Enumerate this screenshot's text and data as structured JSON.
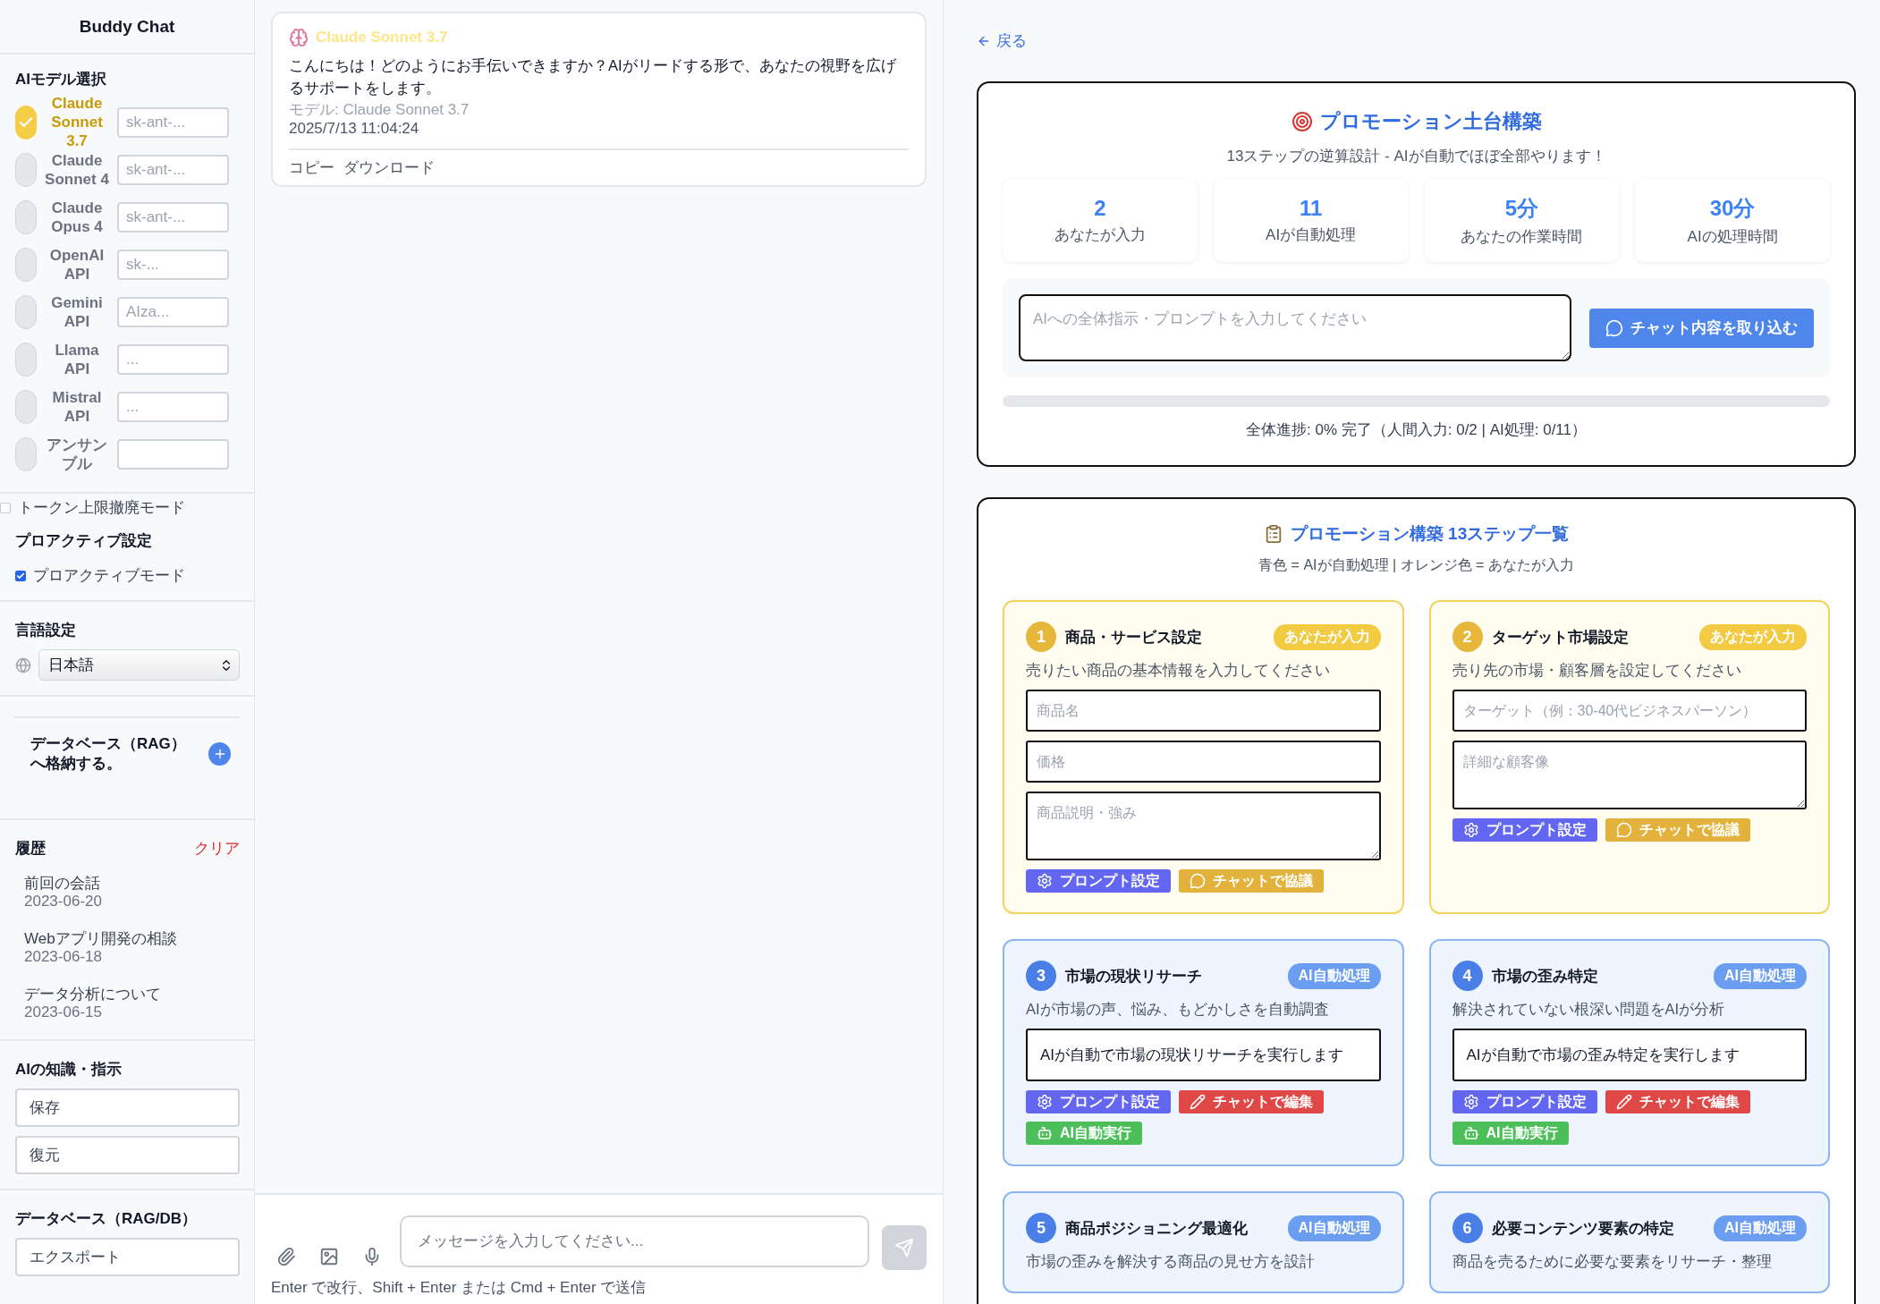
{
  "sidebar": {
    "title": "Buddy Chat",
    "model_heading": "AIモデル選択",
    "models": [
      {
        "name": "Claude Sonnet 3.7",
        "key_placeholder": "sk-ant-...",
        "selected": true
      },
      {
        "name": "Claude Sonnet 4",
        "key_placeholder": "sk-ant-...",
        "selected": false
      },
      {
        "name": "Claude Opus 4",
        "key_placeholder": "sk-ant-...",
        "selected": false
      },
      {
        "name": "OpenAI API",
        "key_placeholder": "sk-...",
        "selected": false
      },
      {
        "name": "Gemini API",
        "key_placeholder": "AIza...",
        "selected": false
      },
      {
        "name": "Llama API",
        "key_placeholder": "...",
        "selected": false
      },
      {
        "name": "Mistral API",
        "key_placeholder": "...",
        "selected": false
      },
      {
        "name": "アンサンブル",
        "selected": false
      }
    ],
    "token_mode": {
      "label": "トークン上限撤廃モード",
      "checked": false
    },
    "proactive": {
      "heading": "プロアクティブ設定",
      "label": "プロアクティブモード",
      "checked": true
    },
    "language": {
      "heading": "言語設定",
      "value": "日本語"
    },
    "rag": {
      "label": "データベース（RAG）へ格納する。"
    },
    "history": {
      "heading": "履歴",
      "clear": "クリア",
      "items": [
        {
          "title": "前回の会話",
          "date": "2023-06-20"
        },
        {
          "title": "Webアプリ開発の相談",
          "date": "2023-06-18"
        },
        {
          "title": "データ分析について",
          "date": "2023-06-15"
        }
      ]
    },
    "knowledge": {
      "heading": "AIの知識・指示",
      "buttons": [
        "保存",
        "復元"
      ]
    },
    "database": {
      "heading": "データベース（RAG/DB）",
      "buttons": [
        "エクスポート"
      ]
    }
  },
  "chat": {
    "messages": [
      {
        "model": "Claude Sonnet 3.7",
        "text": "こんにちは！どのようにお手伝いできますか？AIがリードする形で、あなたの視野を広げるサポートをします。",
        "meta": "モデル: Claude Sonnet 3.7",
        "time": "2025/7/13 11:04:24",
        "actions": [
          "コピー",
          "ダウンロード"
        ]
      }
    ],
    "input": {
      "placeholder": "メッセージを入力してください..."
    },
    "hint": "Enter で改行、Shift + Enter または Cmd + Enter で送信"
  },
  "promo": {
    "back": "戻る",
    "title": "プロモーション土台構築",
    "subtitle": "13ステップの逆算設計 - AIが自動でほぼ全部やります！",
    "stats": [
      {
        "value": "2",
        "label": "あなたが入力"
      },
      {
        "value": "11",
        "label": "AIが自動処理"
      },
      {
        "value": "5分",
        "label": "あなたの作業時間"
      },
      {
        "value": "30分",
        "label": "AIの処理時間"
      }
    ],
    "prompt": {
      "placeholder": "AIへの全体指示・プロンプトを入力してください",
      "button": "チャット内容を取り込む"
    },
    "progress": {
      "level": 0,
      "text": "全体進捗: 0% 完了（人間入力: 0/2 | AI処理: 0/11）"
    },
    "steps_title": "プロモーション構築 13ステップ一覧",
    "legend": "青色 = AIが自動処理 | オレンジ色 = あなたが入力",
    "steps": [
      {
        "number": "1",
        "kind": "input",
        "title": "商品・サービス設定",
        "badge": "あなたが入力",
        "description": "売りたい商品の基本情報を入力してください",
        "fields": [
          {
            "kind": "input",
            "placeholder": "商品名"
          },
          {
            "kind": "input",
            "placeholder": "価格"
          },
          {
            "kind": "textarea",
            "placeholder": "商品説明・強み"
          }
        ],
        "buttons": [
          {
            "kind": "prompt",
            "label": "プロンプト設定"
          },
          {
            "kind": "discuss",
            "label": "チャットで協議"
          }
        ]
      },
      {
        "number": "2",
        "kind": "input",
        "title": "ターゲット市場設定",
        "badge": "あなたが入力",
        "description": "売り先の市場・顧客層を設定してください",
        "fields": [
          {
            "kind": "input",
            "placeholder": "ターゲット（例：30-40代ビジネスパーソン）"
          },
          {
            "kind": "textarea",
            "placeholder": "詳細な顧客像"
          }
        ],
        "buttons": [
          {
            "kind": "prompt",
            "label": "プロンプト設定"
          },
          {
            "kind": "discuss",
            "label": "チャットで協議"
          }
        ]
      },
      {
        "number": "3",
        "kind": "ai",
        "title": "市場の現状リサーチ",
        "badge": "AI自動処理",
        "description": "AIが市場の声、悩み、もどかしさを自動調査",
        "output": "AIが自動で市場の現状リサーチを実行します",
        "buttons": [
          {
            "kind": "prompt",
            "label": "プロンプト設定"
          },
          {
            "kind": "edit",
            "label": "チャットで編集"
          },
          {
            "kind": "run",
            "label": "AI自動実行"
          }
        ]
      },
      {
        "number": "4",
        "kind": "ai",
        "title": "市場の歪み特定",
        "badge": "AI自動処理",
        "description": "解決されていない根深い問題をAIが分析",
        "output": "AIが自動で市場の歪み特定を実行します",
        "buttons": [
          {
            "kind": "prompt",
            "label": "プロンプト設定"
          },
          {
            "kind": "edit",
            "label": "チャットで編集"
          },
          {
            "kind": "run",
            "label": "AI自動実行"
          }
        ]
      },
      {
        "number": "5",
        "kind": "ai",
        "title": "商品ポジショニング最適化",
        "badge": "AI自動処理",
        "description": "市場の歪みを解決する商品の見せ方を設計"
      },
      {
        "number": "6",
        "kind": "ai",
        "title": "必要コンテンツ要素の特定",
        "badge": "AI自動処理",
        "description": "商品を売るために必要な要素をリサーチ・整理"
      }
    ]
  }
}
